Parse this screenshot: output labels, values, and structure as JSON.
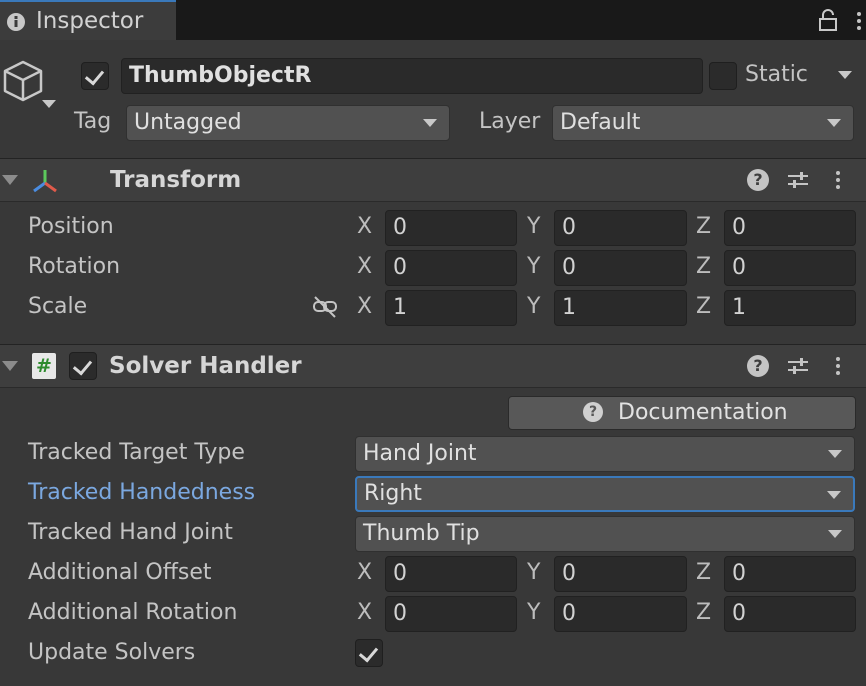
{
  "window": {
    "tab_title": "Inspector"
  },
  "gameobject": {
    "name": "ThumbObjectR",
    "active": true,
    "static_label": "Static",
    "static": false,
    "tag_label": "Tag",
    "tag_value": "Untagged",
    "layer_label": "Layer",
    "layer_value": "Default"
  },
  "transform": {
    "title": "Transform",
    "rows": [
      {
        "label": "Position",
        "x": "0",
        "y": "0",
        "z": "0"
      },
      {
        "label": "Rotation",
        "x": "0",
        "y": "0",
        "z": "0"
      },
      {
        "label": "Scale",
        "x": "1",
        "y": "1",
        "z": "1"
      }
    ]
  },
  "axes": {
    "x": "X",
    "y": "Y",
    "z": "Z"
  },
  "solver": {
    "title": "Solver Handler",
    "enabled": true,
    "doc_button": "Documentation",
    "tracked_target_type_label": "Tracked Target Type",
    "tracked_target_type_value": "Hand Joint",
    "tracked_handedness_label": "Tracked Handedness",
    "tracked_handedness_value": "Right",
    "tracked_hand_joint_label": "Tracked Hand Joint",
    "tracked_hand_joint_value": "Thumb Tip",
    "additional_offset": {
      "label": "Additional Offset",
      "x": "0",
      "y": "0",
      "z": "0"
    },
    "additional_rotation": {
      "label": "Additional Rotation",
      "x": "0",
      "y": "0",
      "z": "0"
    },
    "update_solvers_label": "Update Solvers",
    "update_solvers": true
  },
  "colors": {
    "background": "#383838",
    "accent_focus": "#3a79bb",
    "highlight_label": "#7ba8e0"
  }
}
